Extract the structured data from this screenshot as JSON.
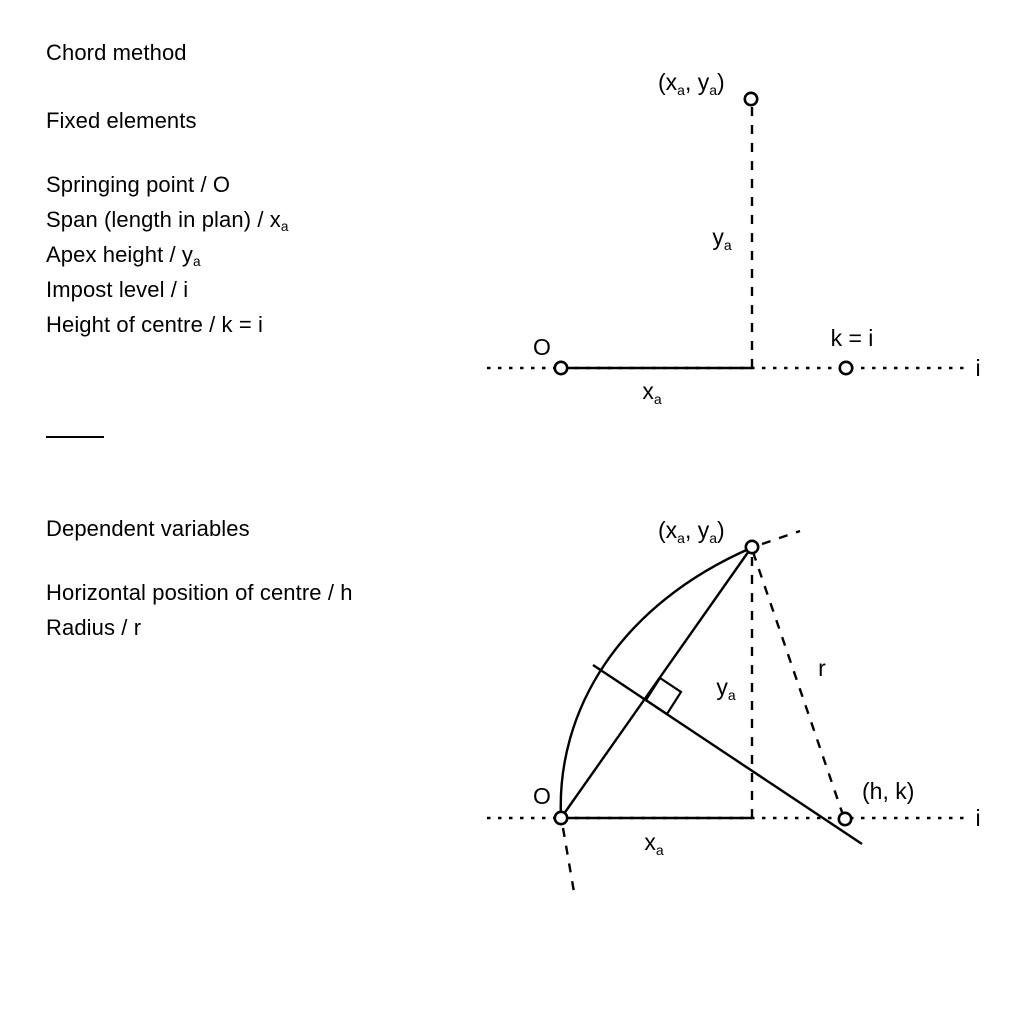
{
  "document": {
    "title": "Chord method",
    "background_color": "#ffffff",
    "ink_color": "#000000"
  },
  "text": {
    "title": "Chord method",
    "section_fixed_heading": "Fixed elements",
    "fixed_elements": [
      "Springing point / O",
      "Span (length in plan) / x",
      "Apex height / y",
      "Impost level / i",
      "Height of centre / k = i"
    ],
    "fixed_elements_parts": [
      {
        "label": "Springing point / O",
        "sub": ""
      },
      {
        "label": "Span (length in plan) / x",
        "sub": "a"
      },
      {
        "label": "Apex height / y",
        "sub": "a"
      },
      {
        "label": "Impost level / i",
        "sub": ""
      },
      {
        "label": "Height of centre / k = i",
        "sub": ""
      }
    ],
    "section_dependent_heading": "Dependent variables",
    "dependent_variables": [
      {
        "label": "Horizontal position of centre / h",
        "sub": ""
      },
      {
        "label": "Radius / r",
        "sub": ""
      }
    ]
  },
  "diagram_top": {
    "name": "fixed-elements-diagram",
    "labels": {
      "apex_point": "(x",
      "apex_point_sub1": "a",
      "apex_point_mid": ", y",
      "apex_point_sub2": "a",
      "apex_point_end": ")",
      "origin": "O",
      "vertical": "y",
      "vertical_sub": "a",
      "horizontal": "x",
      "horizontal_sub": "a",
      "centre_height": "k = i",
      "impost_line": "i"
    }
  },
  "diagram_bottom": {
    "name": "dependent-variables-diagram",
    "labels": {
      "apex_point": "(x",
      "apex_point_sub1": "a",
      "apex_point_mid": ", y",
      "apex_point_sub2": "a",
      "apex_point_end": ")",
      "origin": "O",
      "vertical": "y",
      "vertical_sub": "a",
      "horizontal": "x",
      "horizontal_sub": "a",
      "radius": "r",
      "centre_point": "(h, k)",
      "impost_line": "i"
    }
  }
}
